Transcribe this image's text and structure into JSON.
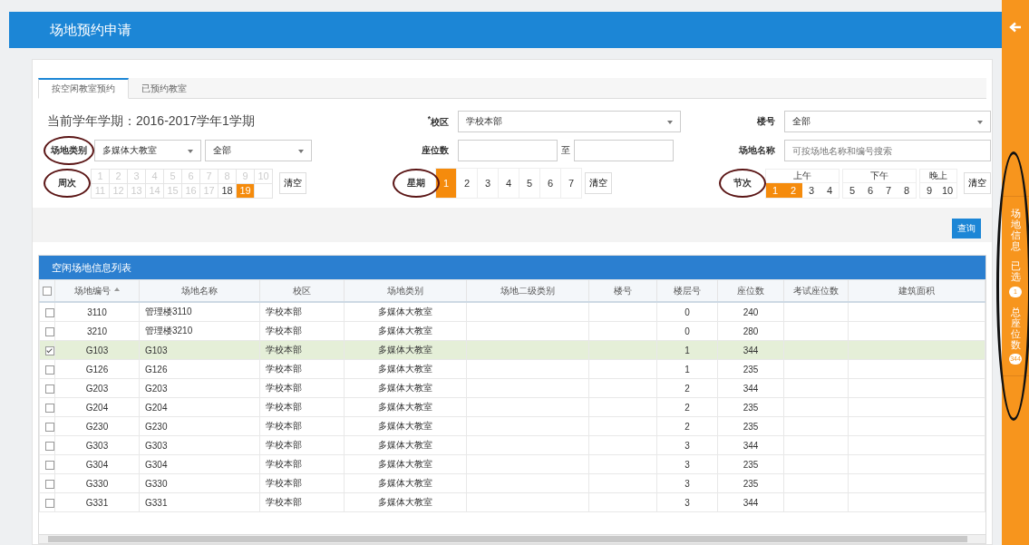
{
  "header": {
    "title": "场地预约申请"
  },
  "sidebar": {
    "circled": true,
    "items": [
      {
        "label": "场地信息"
      },
      {
        "label": "已选",
        "badge": "1"
      },
      {
        "label": "总座位数",
        "badge": "344"
      }
    ]
  },
  "tabs": [
    {
      "label": "按空闲教室预约",
      "selected": true
    },
    {
      "label": "已预约教室",
      "selected": false
    }
  ],
  "form": {
    "term": "当前学年学期：2016-2017学年1学期",
    "campus": {
      "label": "$^{*}$校区",
      "value": "学校本部"
    },
    "building": {
      "label": "楼号",
      "value": "全部"
    },
    "venue_type": {
      "label": "场地类别",
      "circled": true,
      "value": "多媒体大教室",
      "sub_value": "全部"
    },
    "seats": {
      "label": "座位数",
      "separator": "至"
    },
    "venue_name": {
      "label": "场地名称",
      "placeholder": "可按场地名称和编号搜索"
    },
    "weeks": {
      "label": "周次",
      "circled": true,
      "clear": "清空",
      "cells": [
        {
          "label": "1",
          "disabled": true,
          "selected": false
        },
        {
          "label": "2",
          "disabled": true,
          "selected": false
        },
        {
          "label": "3",
          "disabled": true,
          "selected": false
        },
        {
          "label": "4",
          "disabled": true,
          "selected": false
        },
        {
          "label": "5",
          "disabled": true,
          "selected": false
        },
        {
          "label": "6",
          "disabled": true,
          "selected": false
        },
        {
          "label": "7",
          "disabled": true,
          "selected": false
        },
        {
          "label": "8",
          "disabled": true,
          "selected": false
        },
        {
          "label": "9",
          "disabled": true,
          "selected": false
        },
        {
          "label": "10",
          "disabled": true,
          "selected": false
        },
        {
          "label": "11",
          "disabled": true,
          "selected": false
        },
        {
          "label": "12",
          "disabled": true,
          "selected": false
        },
        {
          "label": "13",
          "disabled": true,
          "selected": false
        },
        {
          "label": "14",
          "disabled": true,
          "selected": false
        },
        {
          "label": "15",
          "disabled": true,
          "selected": false
        },
        {
          "label": "16",
          "disabled": true,
          "selected": false
        },
        {
          "label": "17",
          "disabled": true,
          "selected": false
        },
        {
          "label": "18",
          "disabled": false,
          "selected": false
        },
        {
          "label": "19",
          "disabled": false,
          "selected": true
        }
      ]
    },
    "weekdays": {
      "label": "星期",
      "circled": true,
      "clear": "清空",
      "cells": [
        {
          "label": "1",
          "selected": true
        },
        {
          "label": "2",
          "selected": false
        },
        {
          "label": "3",
          "selected": false
        },
        {
          "label": "4",
          "selected": false
        },
        {
          "label": "5",
          "selected": false
        },
        {
          "label": "6",
          "selected": false
        },
        {
          "label": "7",
          "selected": false
        }
      ]
    },
    "periods": {
      "label": "节次",
      "circled": true,
      "clear": "清空",
      "groups": [
        {
          "label": "上午",
          "cells": [
            {
              "label": "1",
              "selected": true
            },
            {
              "label": "2",
              "selected": true
            },
            {
              "label": "3",
              "selected": false
            },
            {
              "label": "4",
              "selected": false
            }
          ]
        },
        {
          "label": "下午",
          "cells": [
            {
              "label": "5",
              "selected": false
            },
            {
              "label": "6",
              "selected": false
            },
            {
              "label": "7",
              "selected": false
            },
            {
              "label": "8",
              "selected": false
            }
          ]
        },
        {
          "label": "晚上",
          "cells": [
            {
              "label": "9",
              "selected": false
            },
            {
              "label": "10",
              "selected": false
            }
          ]
        }
      ]
    },
    "query_button": "查询"
  },
  "table": {
    "title": "空闲场地信息列表",
    "all_checked": false,
    "columns": [
      {
        "label": "场地编号",
        "sortable": true
      },
      {
        "label": "场地名称",
        "sortable": false
      },
      {
        "label": "校区",
        "sortable": false
      },
      {
        "label": "场地类别",
        "sortable": false
      },
      {
        "label": "场地二级类别",
        "sortable": false
      },
      {
        "label": "楼号",
        "sortable": false
      },
      {
        "label": "楼层号",
        "sortable": false
      },
      {
        "label": "座位数",
        "sortable": false
      },
      {
        "label": "考试座位数",
        "sortable": false
      },
      {
        "label": "建筑面积",
        "sortable": false
      }
    ],
    "rows": [
      {
        "checked": false,
        "cells": [
          "3110",
          "管理楼3110",
          "学校本部",
          "多媒体大教室",
          "",
          "",
          "0",
          "240",
          "",
          ""
        ]
      },
      {
        "checked": false,
        "cells": [
          "3210",
          "管理楼3210",
          "学校本部",
          "多媒体大教室",
          "",
          "",
          "0",
          "280",
          "",
          ""
        ]
      },
      {
        "checked": true,
        "cells": [
          "G103",
          "G103",
          "学校本部",
          "多媒体大教室",
          "",
          "",
          "1",
          "344",
          "",
          ""
        ]
      },
      {
        "checked": false,
        "cells": [
          "G126",
          "G126",
          "学校本部",
          "多媒体大教室",
          "",
          "",
          "1",
          "235",
          "",
          ""
        ]
      },
      {
        "checked": false,
        "cells": [
          "G203",
          "G203",
          "学校本部",
          "多媒体大教室",
          "",
          "",
          "2",
          "344",
          "",
          ""
        ]
      },
      {
        "checked": false,
        "cells": [
          "G204",
          "G204",
          "学校本部",
          "多媒体大教室",
          "",
          "",
          "2",
          "235",
          "",
          ""
        ]
      },
      {
        "checked": false,
        "cells": [
          "G230",
          "G230",
          "学校本部",
          "多媒体大教室",
          "",
          "",
          "2",
          "235",
          "",
          ""
        ]
      },
      {
        "checked": false,
        "cells": [
          "G303",
          "G303",
          "学校本部",
          "多媒体大教室",
          "",
          "",
          "3",
          "344",
          "",
          ""
        ]
      },
      {
        "checked": false,
        "cells": [
          "G304",
          "G304",
          "学校本部",
          "多媒体大教室",
          "",
          "",
          "3",
          "235",
          "",
          ""
        ]
      },
      {
        "checked": false,
        "cells": [
          "G330",
          "G330",
          "学校本部",
          "多媒体大教室",
          "",
          "",
          "3",
          "235",
          "",
          ""
        ]
      },
      {
        "checked": false,
        "cells": [
          "G331",
          "G331",
          "学校本部",
          "多媒体大教室",
          "",
          "",
          "3",
          "344",
          "",
          ""
        ]
      }
    ]
  }
}
